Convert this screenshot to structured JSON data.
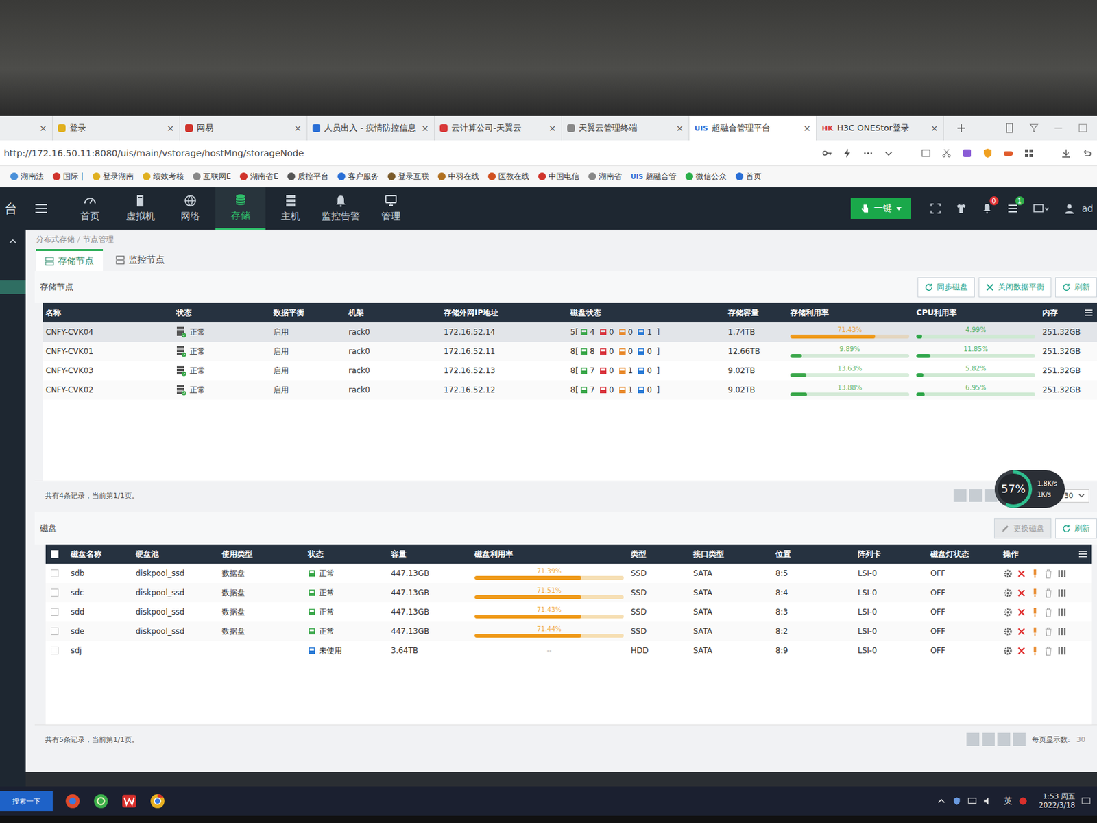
{
  "browser": {
    "close_glyph": "×",
    "tabs": [
      {
        "label": "",
        "badge": "",
        "color": "",
        "selected": false
      },
      {
        "label": "登录",
        "badge": "",
        "color": "#e0b020",
        "selected": false
      },
      {
        "label": "网易",
        "badge": "",
        "color": "#d0342c",
        "selected": false
      },
      {
        "label": "人员出入 - 疫情防控信息",
        "badge": "",
        "color": "#2a6fd6",
        "selected": false
      },
      {
        "label": "云计算公司-天翼云",
        "badge": "",
        "color": "#d83a3a",
        "selected": false
      },
      {
        "label": "天翼云管理终端",
        "badge": "",
        "color": "#888888",
        "selected": false
      },
      {
        "label": "超融合管理平台",
        "badge": "UIS",
        "color": "#2a6fd6",
        "selected": true
      },
      {
        "label": "H3C ONEStor登录",
        "badge": "HK",
        "color": "#d83a3a",
        "selected": false
      }
    ],
    "address": "http://172.16.50.11:8080/uis/main/vstorage/hostMng/storageNode",
    "bookmarks": [
      {
        "label": "湖南法",
        "badge": "",
        "color": "#4a90d9"
      },
      {
        "label": "国际 |",
        "badge": "",
        "color": "#d0342c"
      },
      {
        "label": "登录湖南",
        "badge": "",
        "color": "#e0b020"
      },
      {
        "label": "绩效考核",
        "badge": "",
        "color": "#e0b020"
      },
      {
        "label": "互联网E",
        "badge": "",
        "color": "#888888"
      },
      {
        "label": "湖南省E",
        "badge": "",
        "color": "#d0342c"
      },
      {
        "label": "质控平台",
        "badge": "",
        "color": "#555555"
      },
      {
        "label": "客户服务",
        "badge": "",
        "color": "#2a6fd6"
      },
      {
        "label": "登录互联",
        "badge": "",
        "color": "#7a5a2a"
      },
      {
        "label": "中羽在线",
        "badge": "",
        "color": "#b07020"
      },
      {
        "label": "医教在线",
        "badge": "",
        "color": "#d05020"
      },
      {
        "label": "中国电信",
        "badge": "",
        "color": "#d0342c"
      },
      {
        "label": "湖南省",
        "badge": "",
        "color": "#888888"
      },
      {
        "label": "超融合管",
        "badge": "UIS",
        "color": "#2a6fd6"
      },
      {
        "label": "微信公众",
        "badge": "",
        "color": "#2aae4a"
      },
      {
        "label": "首页",
        "badge": "",
        "color": "#2a6fd6"
      }
    ]
  },
  "app": {
    "sidebar_label": "台",
    "nav": [
      {
        "label": "首页",
        "selected": false
      },
      {
        "label": "虚拟机",
        "selected": false
      },
      {
        "label": "网络",
        "selected": false
      },
      {
        "label": "存储",
        "selected": true
      },
      {
        "label": "主机",
        "selected": false
      },
      {
        "label": "监控告警",
        "selected": false
      },
      {
        "label": "管理",
        "selected": false
      }
    ],
    "quick_button": "一键",
    "notifications": "0",
    "tasks": "1",
    "user": "ad"
  },
  "breadcrumb": [
    "分布式存储",
    "节点管理"
  ],
  "tabs": [
    {
      "label": "存储节点",
      "selected": true
    },
    {
      "label": "监控节点",
      "selected": false
    }
  ],
  "nodes": {
    "title": "存储节点",
    "buttons": [
      {
        "label": "同步磁盘",
        "disabled": false
      },
      {
        "label": "关闭数据平衡",
        "disabled": false
      },
      {
        "label": "刷新",
        "disabled": false
      }
    ],
    "columns": [
      "名称",
      "状态",
      "数据平衡",
      "机架",
      "存储外网IP地址",
      "磁盘状态",
      "存储容量",
      "存储利用率",
      "CPU利用率",
      "内存"
    ],
    "rows": [
      {
        "name": "CNFY-CVK04",
        "status": "正常",
        "balance": "启用",
        "rack": "rack0",
        "ip": "172.16.52.14",
        "disks": {
          "prefix": "5[",
          "counts": [
            {
              "value": "4",
              "color": "#3aa74a"
            },
            {
              "value": "0",
              "color": "#d9363e"
            },
            {
              "value": "0",
              "color": "#e8892b"
            },
            {
              "value": "1",
              "color": "#2b7bd6"
            }
          ],
          "suffix": "]"
        },
        "capacity": "1.74TB",
        "storage": {
          "reading": "71.43%",
          "level": 0.7143,
          "color": "#ef9a1a"
        },
        "cpu": {
          "reading": "4.99%",
          "level": 0.0499
        },
        "memory": "251.32GB",
        "selected": true
      },
      {
        "name": "CNFY-CVK01",
        "status": "正常",
        "balance": "启用",
        "rack": "rack0",
        "ip": "172.16.52.11",
        "disks": {
          "prefix": "8[",
          "counts": [
            {
              "value": "8",
              "color": "#3aa74a"
            },
            {
              "value": "0",
              "color": "#d9363e"
            },
            {
              "value": "0",
              "color": "#e8892b"
            },
            {
              "value": "0",
              "color": "#2b7bd6"
            }
          ],
          "suffix": "]"
        },
        "capacity": "12.66TB",
        "storage": {
          "reading": "9.89%",
          "level": 0.0989,
          "color": "#3aa74a"
        },
        "cpu": {
          "reading": "11.85%",
          "level": 0.1185
        },
        "memory": "251.32GB",
        "selected": false
      },
      {
        "name": "CNFY-CVK03",
        "status": "正常",
        "balance": "启用",
        "rack": "rack0",
        "ip": "172.16.52.13",
        "disks": {
          "prefix": "8[",
          "counts": [
            {
              "value": "7",
              "color": "#3aa74a"
            },
            {
              "value": "0",
              "color": "#d9363e"
            },
            {
              "value": "1",
              "color": "#e8892b"
            },
            {
              "value": "0",
              "color": "#2b7bd6"
            }
          ],
          "suffix": "]"
        },
        "capacity": "9.02TB",
        "storage": {
          "reading": "13.63%",
          "level": 0.1363,
          "color": "#3aa74a"
        },
        "cpu": {
          "reading": "5.82%",
          "level": 0.0582
        },
        "memory": "251.32GB",
        "selected": false
      },
      {
        "name": "CNFY-CVK02",
        "status": "正常",
        "balance": "启用",
        "rack": "rack0",
        "ip": "172.16.52.12",
        "disks": {
          "prefix": "8[",
          "counts": [
            {
              "value": "7",
              "color": "#3aa74a"
            },
            {
              "value": "0",
              "color": "#d9363e"
            },
            {
              "value": "1",
              "color": "#e8892b"
            },
            {
              "value": "0",
              "color": "#2b7bd6"
            }
          ],
          "suffix": "]"
        },
        "capacity": "9.02TB",
        "storage": {
          "reading": "13.88%",
          "level": 0.1388,
          "color": "#3aa74a"
        },
        "cpu": {
          "reading": "6.95%",
          "level": 0.0695
        },
        "memory": "251.32GB",
        "selected": false
      }
    ],
    "footer": "共有4条记录，当前第1/1页。",
    "page_size_label": "每页显示数:",
    "page_size": "30"
  },
  "disks": {
    "title": "磁盘",
    "buttons": [
      {
        "label": "更换磁盘",
        "disabled": true
      },
      {
        "label": "刷新",
        "disabled": false
      }
    ],
    "columns": [
      "磁盘名称",
      "硬盘池",
      "使用类型",
      "状态",
      "容量",
      "磁盘利用率",
      "类型",
      "接口类型",
      "位置",
      "阵列卡",
      "磁盘灯状态",
      "操作"
    ],
    "rows": [
      {
        "name": "sdb",
        "pool": "diskpool_ssd",
        "usage": "数据盘",
        "status": {
          "label": "正常",
          "color": "#3aa74a"
        },
        "capacity": "447.13GB",
        "util": {
          "reading": "71.39%",
          "level": 0.7139
        },
        "type": "SSD",
        "interface": "SATA",
        "position": "8:5",
        "raid": "LSI-0",
        "light": "OFF",
        "checked": false
      },
      {
        "name": "sdc",
        "pool": "diskpool_ssd",
        "usage": "数据盘",
        "status": {
          "label": "正常",
          "color": "#3aa74a"
        },
        "capacity": "447.13GB",
        "util": {
          "reading": "71.51%",
          "level": 0.7151
        },
        "type": "SSD",
        "interface": "SATA",
        "position": "8:4",
        "raid": "LSI-0",
        "light": "OFF",
        "checked": false
      },
      {
        "name": "sdd",
        "pool": "diskpool_ssd",
        "usage": "数据盘",
        "status": {
          "label": "正常",
          "color": "#3aa74a"
        },
        "capacity": "447.13GB",
        "util": {
          "reading": "71.43%",
          "level": 0.7143
        },
        "type": "SSD",
        "interface": "SATA",
        "position": "8:3",
        "raid": "LSI-0",
        "light": "OFF",
        "checked": false
      },
      {
        "name": "sde",
        "pool": "diskpool_ssd",
        "usage": "数据盘",
        "status": {
          "label": "正常",
          "color": "#3aa74a"
        },
        "capacity": "447.13GB",
        "util": {
          "reading": "71.44%",
          "level": 0.7144
        },
        "type": "SSD",
        "interface": "SATA",
        "position": "8:2",
        "raid": "LSI-0",
        "light": "OFF",
        "checked": false
      },
      {
        "name": "sdj",
        "pool": "",
        "usage": "",
        "status": {
          "label": "未使用",
          "color": "#2b7bd6"
        },
        "capacity": "3.64TB",
        "util": {
          "reading": "--",
          "level": 0
        },
        "type": "HDD",
        "interface": "SATA",
        "position": "8:9",
        "raid": "LSI-0",
        "light": "OFF",
        "checked": false
      }
    ],
    "footer": "共有5条记录，当前第1/1页。",
    "page_size_label": "每页显示数:",
    "page_size": "30"
  },
  "speed_widget": {
    "percent": "57%",
    "level": 0.57,
    "up": "1.8K/s",
    "down": "1K/s"
  },
  "taskbar": {
    "search": "搜索一下",
    "ime": "英",
    "time": "1:53 周五",
    "date": "2022/3/18"
  }
}
